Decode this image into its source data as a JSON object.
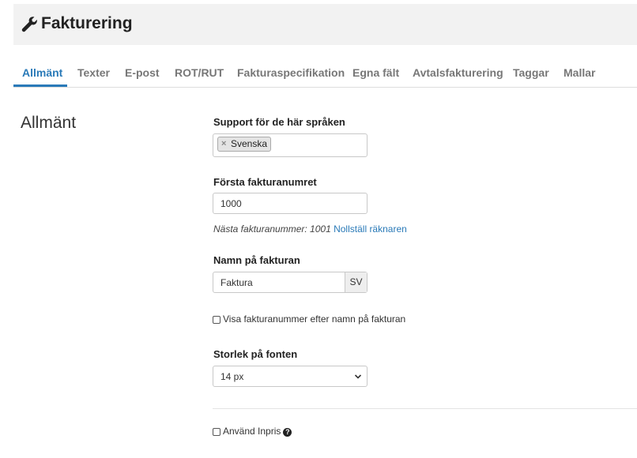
{
  "header": {
    "icon": "wrench-icon",
    "title": "Fakturering"
  },
  "tabs": [
    {
      "label": "Allmänt",
      "active": true
    },
    {
      "label": "Texter"
    },
    {
      "label": "E-post"
    },
    {
      "label": "ROT/RUT"
    },
    {
      "label": "Fakturaspecifikation"
    },
    {
      "label": "Egna fält"
    },
    {
      "label": "Avtalsfakturering"
    },
    {
      "label": "Taggar"
    },
    {
      "label": "Mallar"
    }
  ],
  "section": {
    "title": "Allmänt"
  },
  "languages": {
    "label": "Support för de här språken",
    "selected_tag": "Svenska",
    "remove_glyph": "×"
  },
  "first_invoice": {
    "label": "Första fakturanumret",
    "value": "1000",
    "hint_prefix": "Nästa fakturanummer: 1001",
    "reset_link": "Nollställ räknaren"
  },
  "invoice_name": {
    "label": "Namn på fakturan",
    "value": "Faktura",
    "lang_addon": "SV"
  },
  "show_number_checkbox": {
    "label": "Visa fakturanummer efter namn på fakturan",
    "checked": false
  },
  "font_size": {
    "label": "Storlek på fonten",
    "value": "14 px"
  },
  "purchase_price_checkbox": {
    "label": "Använd Inpris",
    "checked": false,
    "help_glyph": "?"
  },
  "colors": {
    "accent": "#2a7ab8",
    "header_bg": "#f2f2f2"
  }
}
